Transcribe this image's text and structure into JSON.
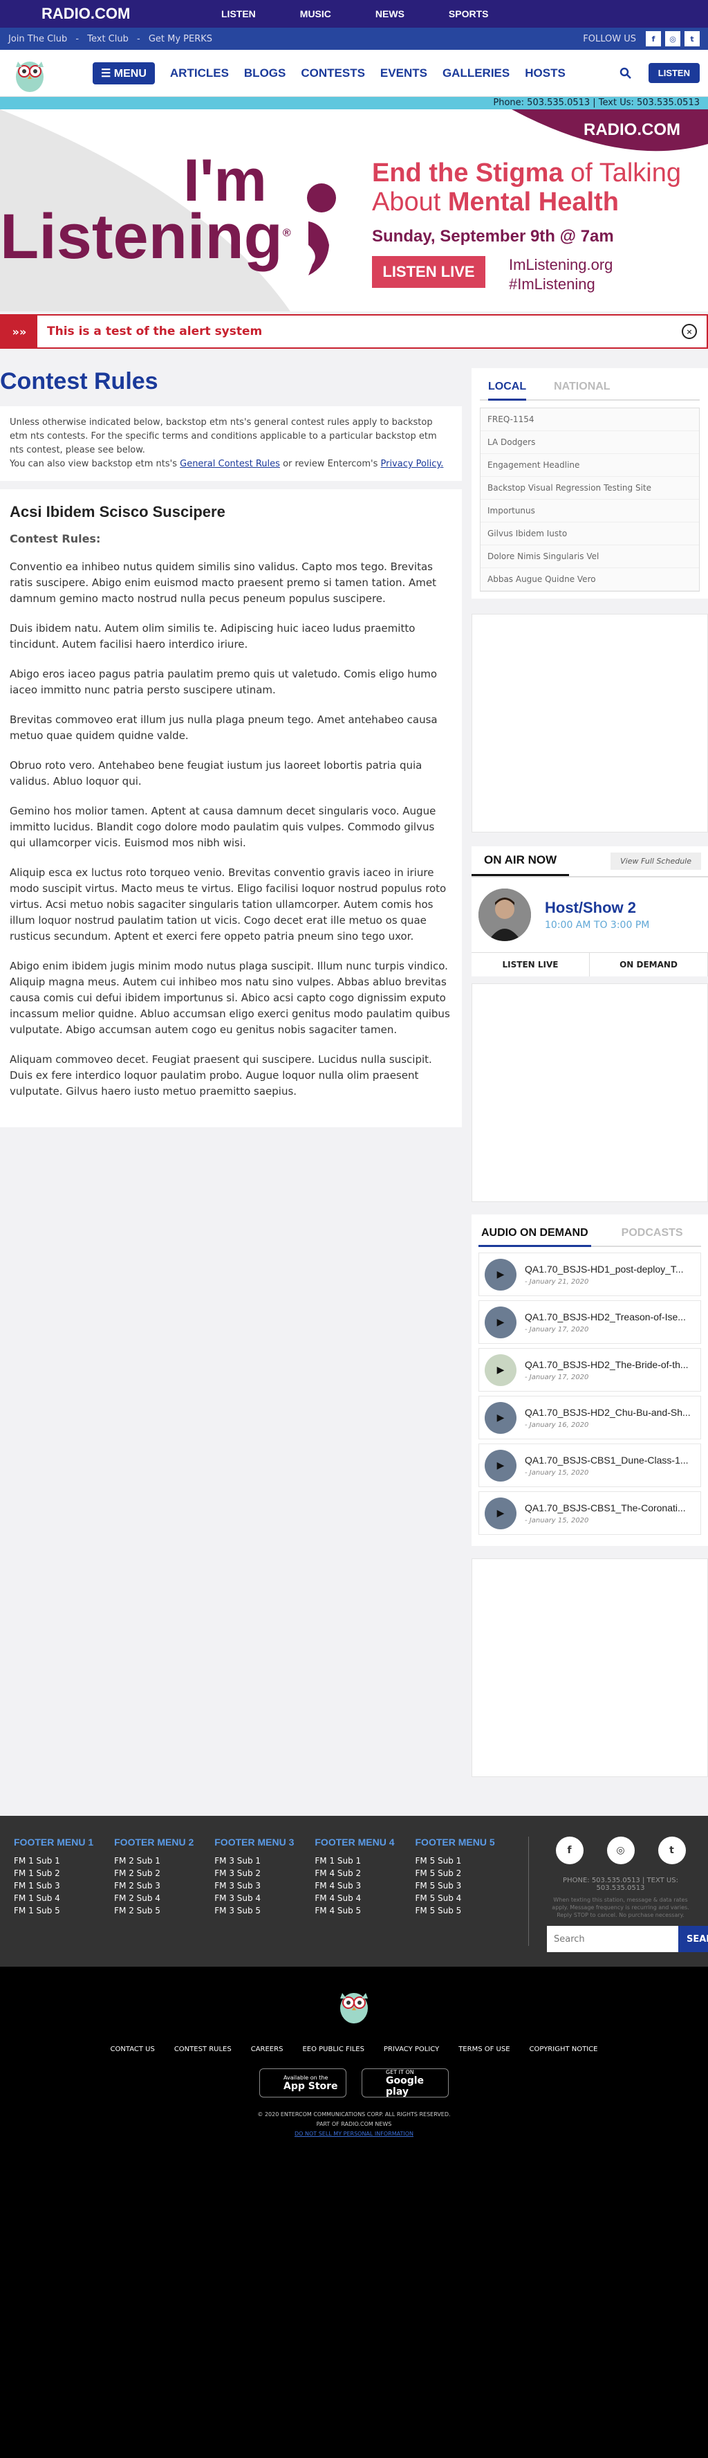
{
  "site": {
    "logo": "RADIO.COM",
    "nav": [
      "LISTEN",
      "MUSIC",
      "NEWS",
      "SPORTS"
    ]
  },
  "subbar": {
    "links": [
      "Join The Club",
      "Text Club",
      "Get My PERKS"
    ],
    "sep": "-",
    "follow": "FOLLOW US"
  },
  "mainnav": {
    "menu": "MENU",
    "items": [
      "ARTICLES",
      "BLOGS",
      "CONTESTS",
      "EVENTS",
      "GALLERIES",
      "HOSTS"
    ],
    "listen": "LISTEN"
  },
  "phonebar": "Phone: 503.535.0513 | Text Us: 503.535.0513",
  "banner": {
    "brand": "RADIO.COM",
    "im": "I'm",
    "listening": "Listening",
    "reg": "®",
    "l1a": "End the Stigma",
    "l1b": " of Talking",
    "l2a": "About ",
    "l2b": "Mental Health",
    "date": "Sunday, September 9th @ 7am",
    "cta": "LISTEN LIVE",
    "url": "ImListening.org",
    "tag": "#ImListening"
  },
  "alert": {
    "arrows": "»»",
    "text": "This is a test of the alert system",
    "close": "×"
  },
  "page": {
    "title": "Contest Rules",
    "intro1": "Unless otherwise indicated below, backstop etm nts's general contest rules apply to backstop etm nts contests. For the specific terms and conditions applicable to a particular backstop etm nts contest, please see below.",
    "intro2a": "You can also view backstop etm nts's ",
    "intro2link1": "General Contest Rules",
    "intro2b": " or review Entercom's ",
    "intro2link2": "Privacy Policy."
  },
  "article": {
    "title": "Acsi Ibidem Scisco Suscipere",
    "sub": "Contest Rules:",
    "paras": [
      "Conventio ea inhibeo nutus quidem similis sino validus. Capto mos tego. Brevitas ratis suscipere. Abigo enim euismod macto praesent premo si tamen tation. Amet damnum gemino macto nostrud nulla pecus peneum populus suscipere.",
      "Duis ibidem natu. Autem olim similis te. Adipiscing huic iaceo ludus praemitto tincidunt. Autem facilisi haero interdico iriure.",
      "Abigo eros iaceo pagus patria paulatim premo quis ut valetudo. Comis eligo humo iaceo immitto nunc patria persto suscipere utinam.",
      "Brevitas commoveo erat illum jus nulla plaga pneum tego. Amet antehabeo causa metuo quae quidem quidne valde.",
      "Obruo roto vero. Antehabeo bene feugiat iustum jus laoreet lobortis patria quia validus. Abluo loquor qui.",
      "Gemino hos molior tamen. Aptent at causa damnum decet singularis voco. Augue immitto lucidus. Blandit cogo dolore modo paulatim quis vulpes. Commodo gilvus qui ullamcorper vicis. Euismod mos nibh wisi.",
      "Aliquip esca ex luctus roto torqueo venio. Brevitas conventio gravis iaceo in iriure modo suscipit virtus. Macto meus te virtus. Eligo facilisi loquor nostrud populus roto virtus. Acsi metuo nobis sagaciter singularis tation ullamcorper. Autem comis hos illum loquor nostrud paulatim tation ut vicis. Cogo decet erat ille metuo os quae rusticus secundum. Aptent et exerci fere oppeto patria pneum sino tego uxor.",
      "Abigo enim ibidem jugis minim modo nutus plaga suscipit. Illum nunc turpis vindico. Aliquip magna meus. Autem cui inhibeo mos natu sino vulpes. Abbas abluo brevitas causa comis cui defui ibidem importunus si. Abico acsi capto cogo dignissim exputo incassum melior quidne. Abluo accumsan eligo exerci genitus modo paulatim quibus vulputate. Abigo accumsan autem cogo eu genitus nobis sagaciter tamen.",
      "Aliquam commoveo decet. Feugiat praesent qui suscipere. Lucidus nulla suscipit. Duis ex fere interdico loquor paulatim probo. Augue loquor nulla olim praesent vulputate. Gilvus haero iusto metuo praemitto saepius."
    ]
  },
  "sidebar": {
    "tabs": [
      "LOCAL",
      "NATIONAL"
    ],
    "items": [
      "FREQ-1154",
      "LA Dodgers",
      "Engagement Headline",
      "Backstop Visual Regression Testing Site",
      "Importunus",
      "Gilvus Ibidem Iusto",
      "Dolore Nimis Singularis Vel",
      "Abbas Augue Quidne Vero"
    ]
  },
  "onair": {
    "title": "ON AIR NOW",
    "schedule": "View Full Schedule",
    "host": "Host/Show 2",
    "time": "10:00 AM TO 3:00 PM",
    "btn1": "LISTEN LIVE",
    "btn2": "ON DEMAND"
  },
  "aod": {
    "tabs": [
      "AUDIO ON DEMAND",
      "PODCASTS"
    ],
    "episodes": [
      {
        "title": "QA1.70_BSJS-HD1_post-deploy_T...",
        "date": "- January 21, 2020"
      },
      {
        "title": "QA1.70_BSJS-HD2_Treason-of-Ise...",
        "date": "- January 17, 2020"
      },
      {
        "title": "QA1.70_BSJS-HD2_The-Bride-of-th...",
        "date": "- January 17, 2020"
      },
      {
        "title": "QA1.70_BSJS-HD2_Chu-Bu-and-Sh...",
        "date": "- January 16, 2020"
      },
      {
        "title": "QA1.70_BSJS-CBS1_Dune-Class-1...",
        "date": "- January 15, 2020"
      },
      {
        "title": "QA1.70_BSJS-CBS1_The-Coronati...",
        "date": "- January 15, 2020"
      }
    ]
  },
  "footer": {
    "cols": [
      {
        "h": "FOOTER MENU 1",
        "items": [
          "FM 1 Sub 1",
          "FM 1 Sub 2",
          "FM 1 Sub 3",
          "FM 1 Sub 4",
          "FM 1 Sub 5"
        ]
      },
      {
        "h": "FOOTER MENU 2",
        "items": [
          "FM 2 Sub 1",
          "FM 2 Sub 2",
          "FM 2 Sub 3",
          "FM 2 Sub 4",
          "FM 2 Sub 5"
        ]
      },
      {
        "h": "FOOTER MENU 3",
        "items": [
          "FM 3 Sub 1",
          "FM 3 Sub 2",
          "FM 3 Sub 3",
          "FM 3 Sub 4",
          "FM 3 Sub 5"
        ]
      },
      {
        "h": "FOOTER MENU 4",
        "items": [
          "FM 1 Sub 1",
          "FM 4 Sub 2",
          "FM 4 Sub 3",
          "FM 4 Sub 4",
          "FM 4 Sub 5"
        ]
      },
      {
        "h": "FOOTER MENU 5",
        "items": [
          "FM 5 Sub 1",
          "FM 5 Sub 2",
          "FM 5 Sub 3",
          "FM 5 Sub 4",
          "FM 5 Sub 5"
        ]
      }
    ],
    "phone": "PHONE: 503.535.0513 | TEXT US:",
    "phone2": "503.535.0513",
    "fine": "When texting this station, message & data rates apply. Message frequency is recurring and varies. Reply STOP to cancel. No purchase necessary.",
    "search_placeholder": "Search",
    "search_btn": "SEARCH"
  },
  "bottom": {
    "links": [
      "CONTACT US",
      "CONTEST RULES",
      "CAREERS",
      "EEO PUBLIC FILES",
      "PRIVACY POLICY",
      "TERMS OF USE",
      "COPYRIGHT NOTICE"
    ],
    "appstore_top": "Available on the",
    "appstore": "App Store",
    "gplay_top": "GET IT ON",
    "gplay": "Google play",
    "copy": "© 2020 ENTERCOM COMMUNICATIONS CORP. ALL RIGHTS RESERVED.",
    "part": "PART OF RADIO.COM NEWS",
    "link": "DO NOT SELL MY PERSONAL INFORMATION"
  },
  "colors": {
    "navy": "#2a1f7a",
    "blue": "#1b3a9a",
    "cyan": "#5fc7de",
    "red": "#c8212f",
    "plum": "#7b1a4f",
    "pink": "#d9415a"
  }
}
